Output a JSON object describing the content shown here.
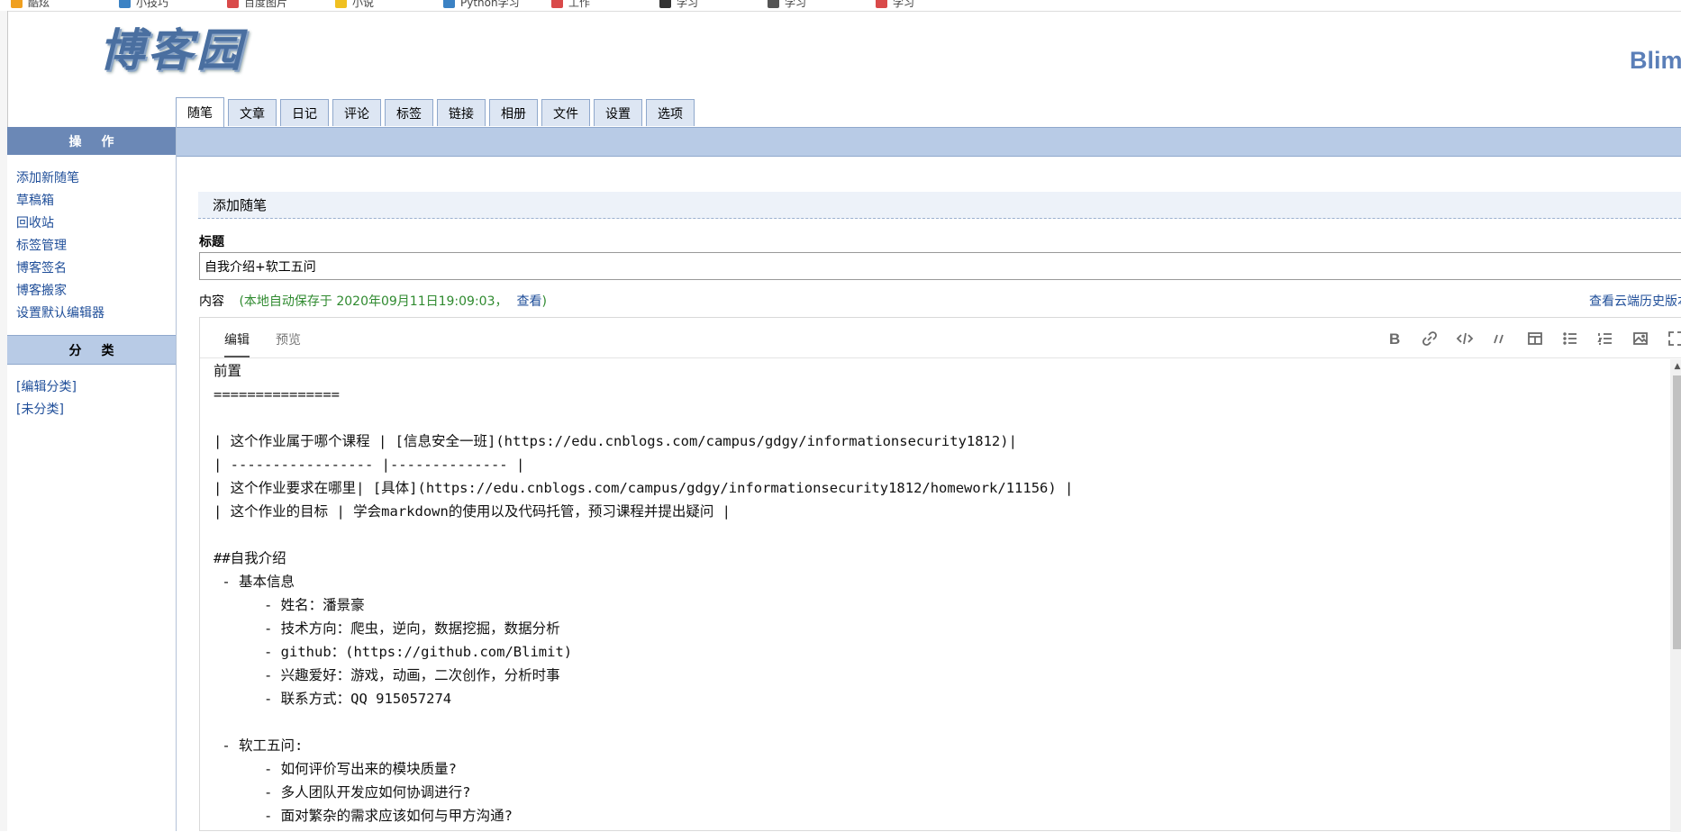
{
  "bookmarks": [
    "酷炫",
    "小技巧",
    "百度图片",
    "小说",
    "Python学习",
    "工作",
    "学习",
    "学习",
    "学习"
  ],
  "logo_text": "博客园",
  "user_name": "Blim",
  "tabs": [
    "随笔",
    "文章",
    "日记",
    "评论",
    "标签",
    "链接",
    "相册",
    "文件",
    "设置",
    "选项"
  ],
  "sidebar": {
    "ops_title": "操作",
    "ops_items": [
      "添加新随笔",
      "草稿箱",
      "回收站",
      "标签管理",
      "博客签名",
      "博客搬家",
      "设置默认编辑器"
    ],
    "cat_title": "分类",
    "cat_items": [
      "[编辑分类]",
      "[未分类]"
    ]
  },
  "main": {
    "section_title": "添加随笔",
    "title_label": "标题",
    "title_value": "自我介绍+软工五问",
    "content_label": "内容",
    "autosave_text": "(本地自动保存于 2020年09月11日19:09:03，",
    "autosave_link": "查看",
    "autosave_close": ")",
    "cloud_history": "查看云端历史版本"
  },
  "editor": {
    "tab_edit": "编辑",
    "tab_preview": "预览",
    "tools": [
      "bold-icon",
      "link-icon",
      "code-icon",
      "quote-icon",
      "table-icon",
      "bulleted-list-icon",
      "numbered-list-icon",
      "image-icon",
      "fullscreen-icon"
    ],
    "lines": [
      "前置",
      "===============",
      "",
      "| 这个作业属于哪个课程 | [信息安全一班](https://edu.cnblogs.com/campus/gdgy/informationsecurity1812)|",
      "| ----------------- |-------------- |",
      "| 这个作业要求在哪里| [具体](https://edu.cnblogs.com/campus/gdgy/informationsecurity1812/homework/11156) |",
      "| 这个作业的目标 | 学会markdown的使用以及代码托管，预习课程并提出疑问 |",
      "",
      "##自我介绍",
      " - 基本信息",
      "      - 姓名：潘景豪",
      "      - 技术方向：爬虫，逆向，数据挖掘，数据分析",
      "      - github：(https://github.com/Blimit)",
      "      - 兴趣爱好：游戏，动画，二次创作，分析时事",
      "      - 联系方式：QQ 915057274",
      "",
      " - 软工五问:",
      "      - 如何评价写出来的模块质量?",
      "      - 多人团队开发应如何协调进行?",
      "      - 面对繁杂的需求应该如何与甲方沟通?"
    ]
  }
}
